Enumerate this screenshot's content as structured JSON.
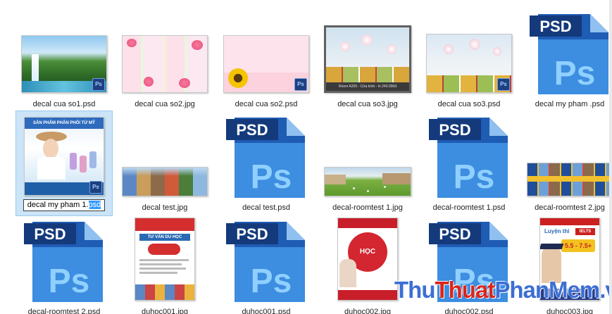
{
  "files": [
    {
      "id": "f1",
      "name": "decal cua so1.psd"
    },
    {
      "id": "f2",
      "name": "decal cua so2.jpg"
    },
    {
      "id": "f3",
      "name": "decal cua so2.psd"
    },
    {
      "id": "f4",
      "name": "decal cua so3.jpg",
      "caption": "Room A205 - Cửa kính - In 240.000đ"
    },
    {
      "id": "f5",
      "name": "decal cua so3.psd"
    },
    {
      "id": "f6",
      "name": "decal my pham .psd"
    },
    {
      "id": "f7",
      "name_before_selection": "decal my pham 1.",
      "name_selected": "psd",
      "poster_title": "SẢN PHẨM PHÂN PHỐI TỪ MỸ"
    },
    {
      "id": "f8",
      "name": "decal test.jpg"
    },
    {
      "id": "f9",
      "name": "decal test.psd"
    },
    {
      "id": "f10",
      "name": "decal-roomtest 1.jpg"
    },
    {
      "id": "f11",
      "name": "decal-roomtest 1.psd"
    },
    {
      "id": "f12",
      "name": "decal-roomtest 2.jpg"
    },
    {
      "id": "f13",
      "name": "decal-roomtest 2.psd"
    },
    {
      "id": "f14",
      "name": "duhoc001.jpg",
      "headline": "TƯ VẤN DU HỌC"
    },
    {
      "id": "f15",
      "name": "duhoc001.psd"
    },
    {
      "id": "f16",
      "name": "duhoc002.jpg",
      "headline": "HỌC"
    },
    {
      "id": "f17",
      "name": "duhoc002.psd"
    },
    {
      "id": "f18",
      "name": "duhoc003.jpg",
      "headline": "IELTS",
      "score": "5.5 - 7.5+",
      "brand": "Luyện thi"
    }
  ],
  "icon": {
    "psd_label": "PSD",
    "ps_label": "Ps",
    "badge_label": "Ps",
    "colors": {
      "dark": "#143a7c",
      "mid": "#1f5cb4",
      "light": "#3d8de0",
      "text": "#8fd0ff"
    }
  },
  "watermark": {
    "part1": "Thu",
    "part2": "Thuat",
    "part3": "PhanMem",
    "part4": ".vn"
  }
}
